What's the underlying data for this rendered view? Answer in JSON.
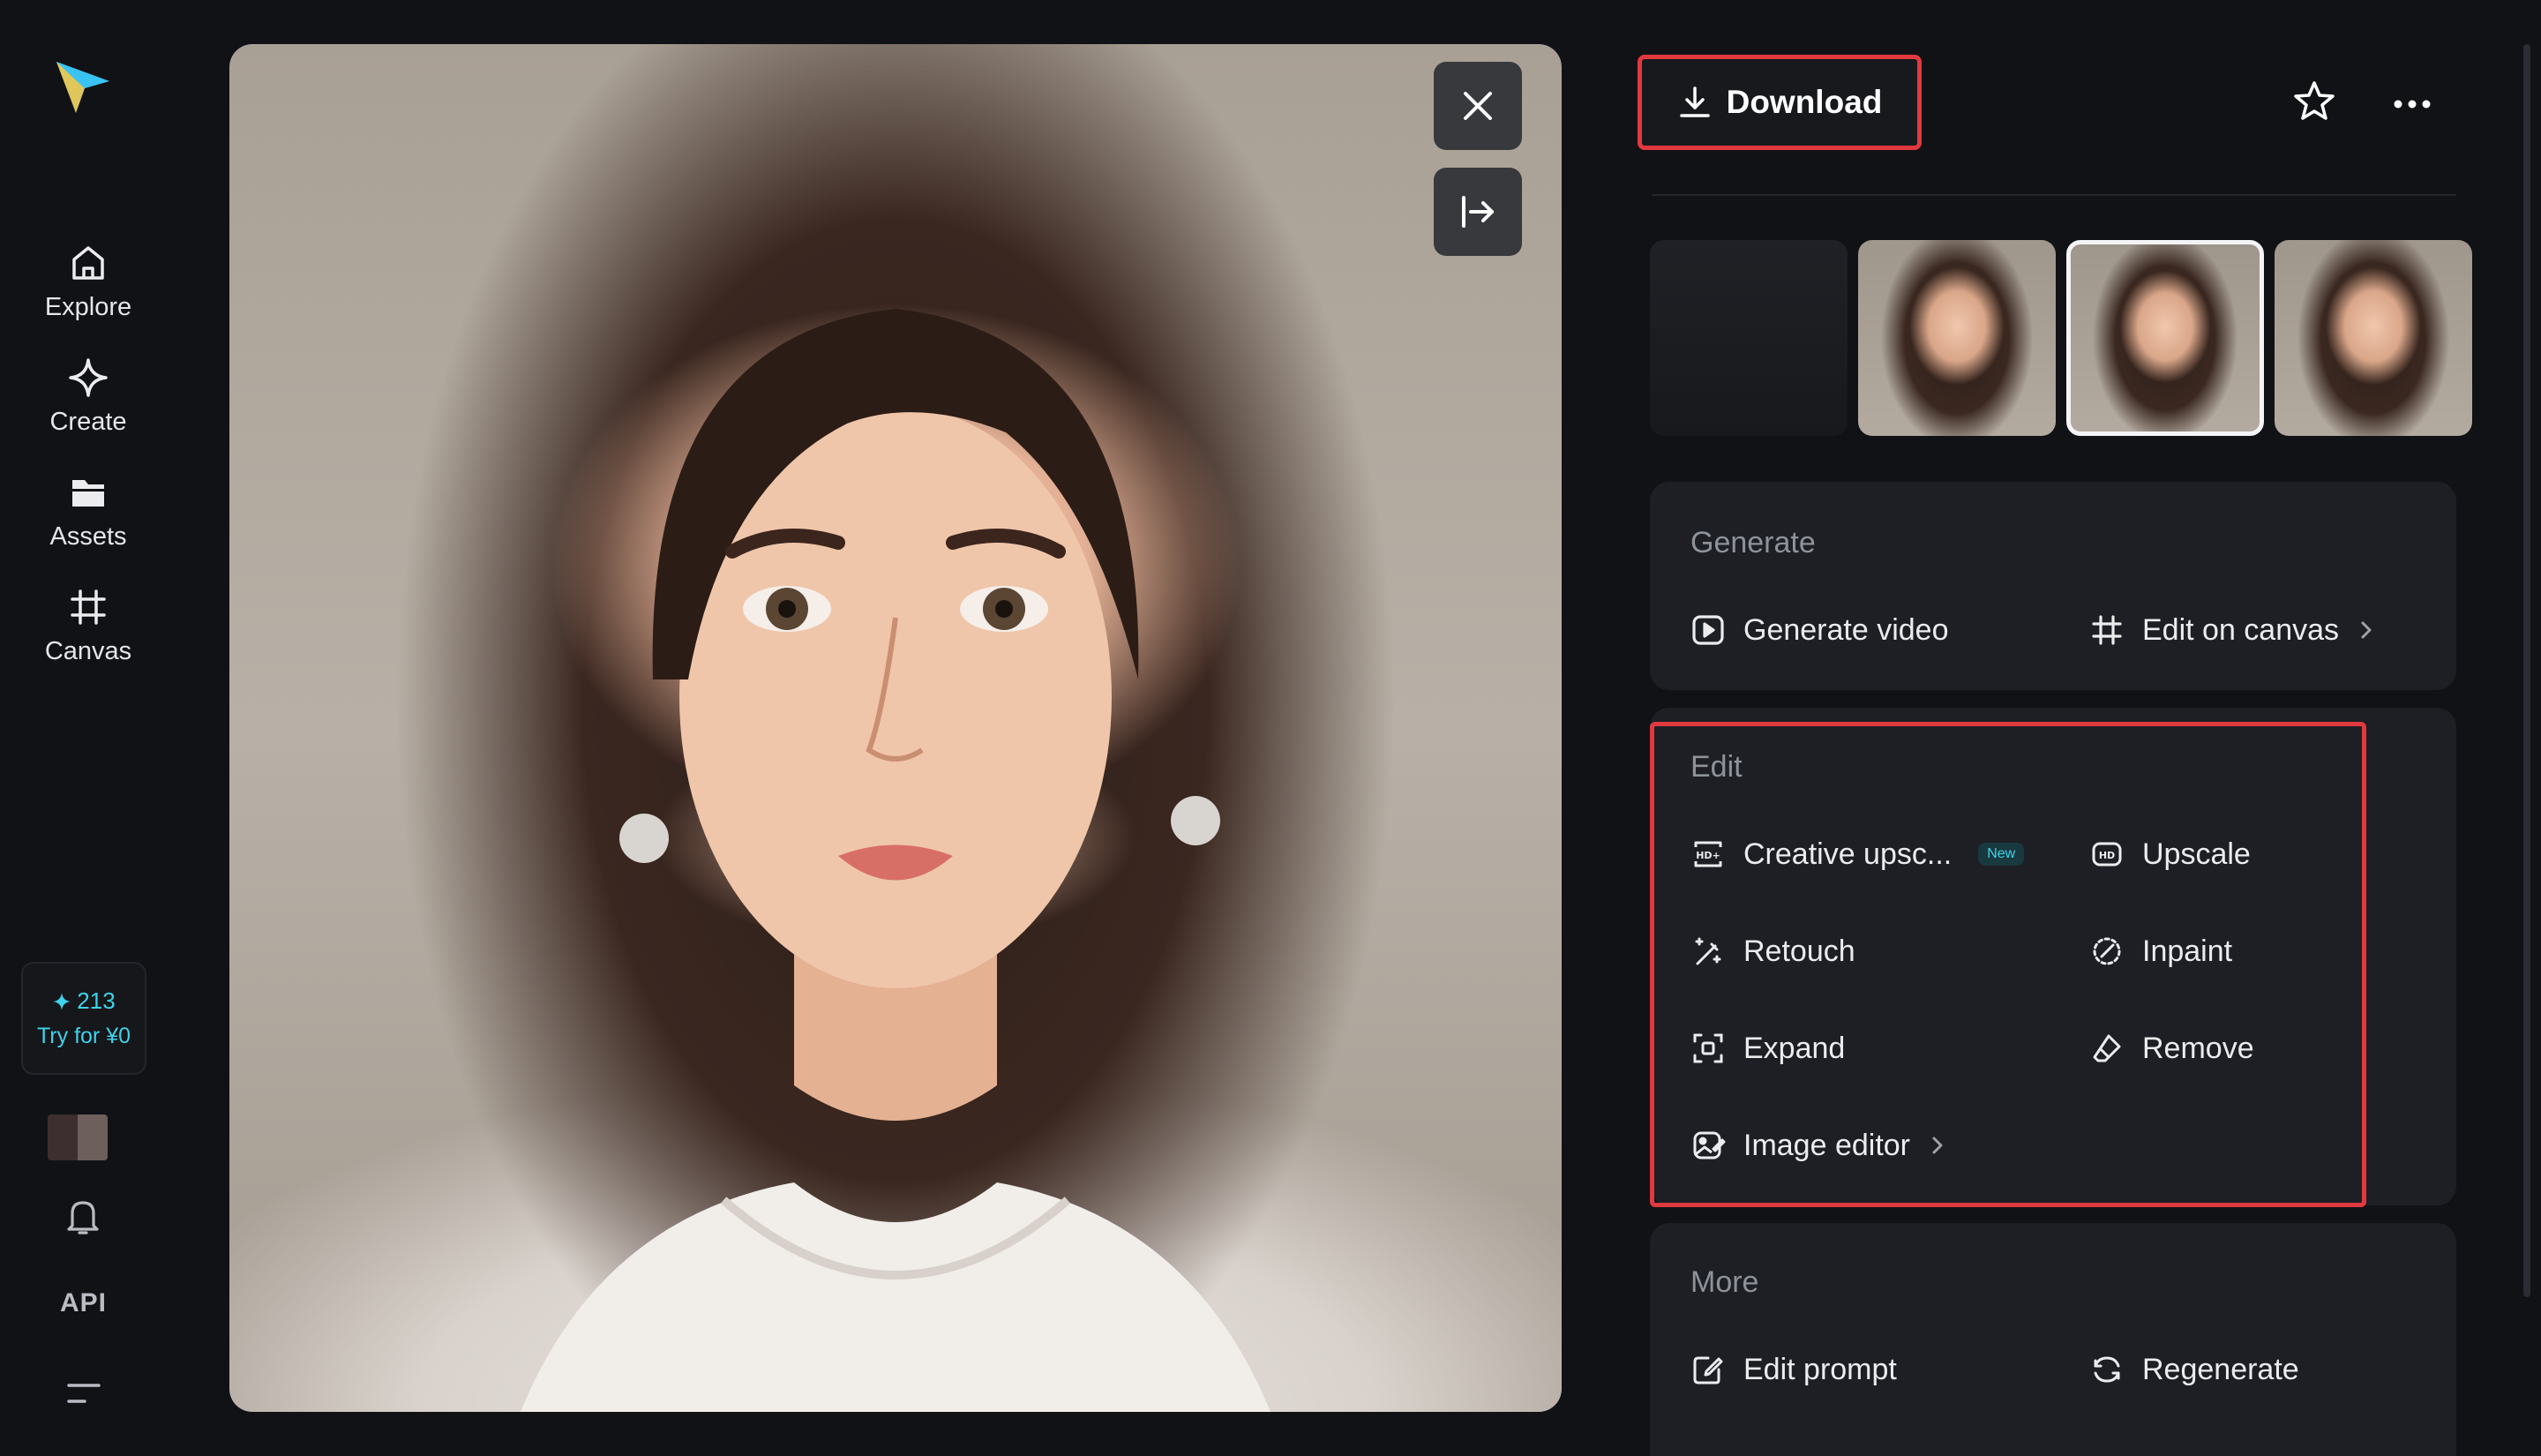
{
  "nav": {
    "items": [
      {
        "label": "Explore",
        "icon": "home-icon"
      },
      {
        "label": "Create",
        "icon": "sparkle-diamond-icon"
      },
      {
        "label": "Assets",
        "icon": "folder-icon"
      },
      {
        "label": "Canvas",
        "icon": "frame-grid-icon"
      }
    ],
    "credits": {
      "count": "213",
      "cta": "Try for ¥0"
    },
    "api_label": "API"
  },
  "toolbar": {
    "download_label": "Download"
  },
  "sections": {
    "generate": {
      "title": "Generate",
      "actions": [
        {
          "label": "Generate video",
          "icon": "play-square-icon"
        },
        {
          "label": "Edit on canvas",
          "icon": "frame-grid-icon"
        }
      ]
    },
    "edit": {
      "title": "Edit",
      "new_badge": "New",
      "actions": [
        {
          "label": "Creative upsc...",
          "icon": "hd-plus-icon"
        },
        {
          "label": "Upscale",
          "icon": "hd-icon"
        },
        {
          "label": "Retouch",
          "icon": "magic-wand-icon"
        },
        {
          "label": "Inpaint",
          "icon": "inpaint-brush-icon"
        },
        {
          "label": "Expand",
          "icon": "expand-frame-icon"
        },
        {
          "label": "Remove",
          "icon": "eraser-icon"
        },
        {
          "label": "Image editor",
          "icon": "image-edit-icon"
        }
      ]
    },
    "more": {
      "title": "More",
      "actions": [
        {
          "label": "Edit prompt",
          "icon": "edit-prompt-icon"
        },
        {
          "label": "Regenerate",
          "icon": "regenerate-icon"
        }
      ]
    }
  },
  "colors": {
    "background": "#111215",
    "card": "#1d1f24",
    "accent_cyan": "#3fd2ea",
    "highlight_red": "#e0393e"
  }
}
